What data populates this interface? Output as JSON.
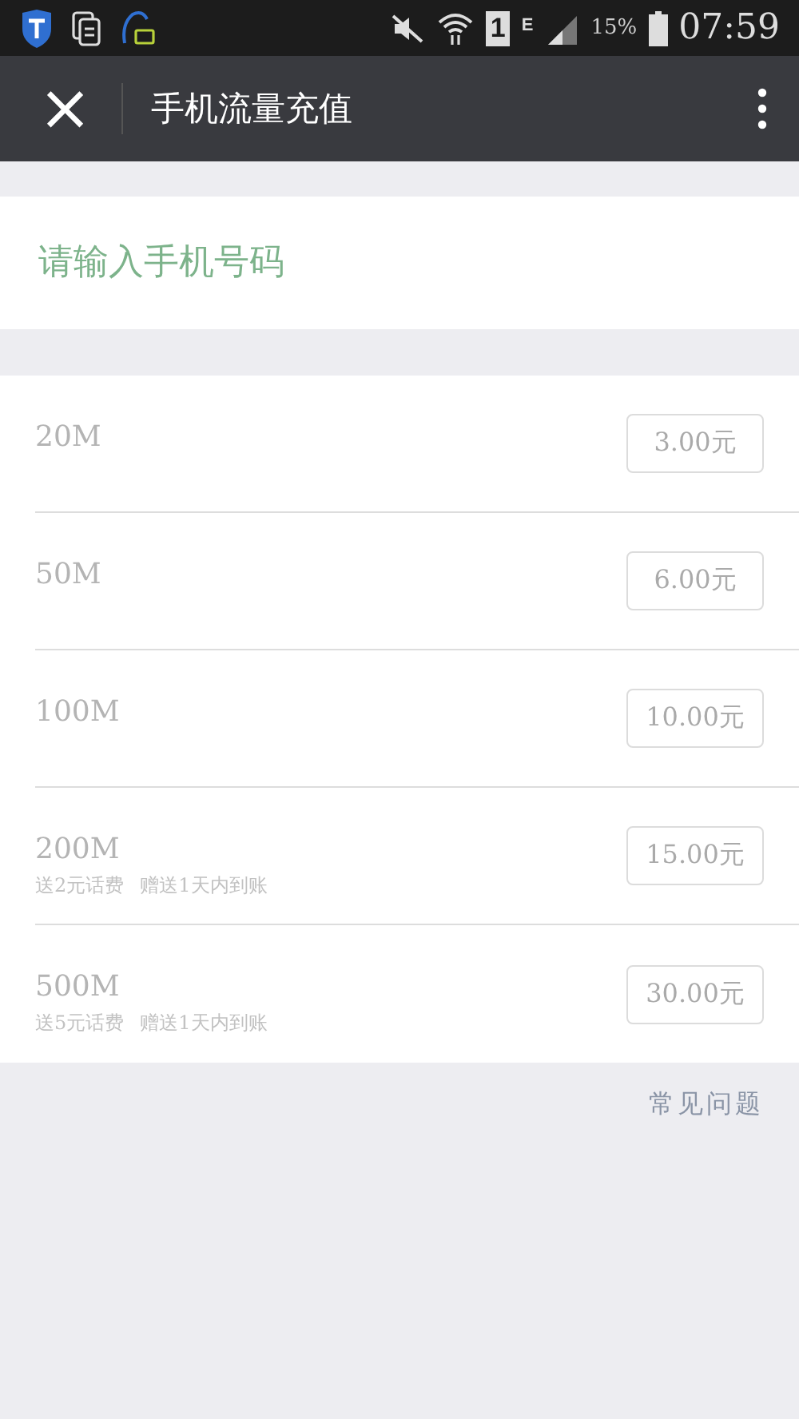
{
  "status_bar": {
    "sim": "1",
    "network": "E",
    "battery": "15%",
    "time": "07:59"
  },
  "app_bar": {
    "close": "×",
    "title": "手机流量充值"
  },
  "phone_field": {
    "placeholder": "请输入手机号码"
  },
  "plans": [
    {
      "name": "20M",
      "price": "3.00元"
    },
    {
      "name": "50M",
      "price": "6.00元"
    },
    {
      "name": "100M",
      "price": "10.00元"
    },
    {
      "name": "200M",
      "notes": [
        "送2元话费",
        "赠送1天内到账"
      ],
      "price": "15.00元"
    },
    {
      "name": "500M",
      "notes": [
        "送5元话费",
        "赠送1天内到账"
      ],
      "price": "30.00元"
    }
  ],
  "faq_link": "常见问题"
}
